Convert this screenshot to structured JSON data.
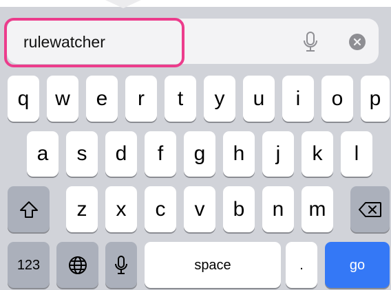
{
  "search": {
    "value": "rulewatcher"
  },
  "keyboard": {
    "row1": [
      "q",
      "w",
      "e",
      "r",
      "t",
      "y",
      "u",
      "i",
      "o",
      "p"
    ],
    "row2": [
      "a",
      "s",
      "d",
      "f",
      "g",
      "h",
      "j",
      "k",
      "l"
    ],
    "row3": [
      "z",
      "x",
      "c",
      "v",
      "b",
      "n",
      "m"
    ],
    "numbers_label": "123",
    "space_label": "space",
    "period_label": ".",
    "go_label": "go"
  },
  "colors": {
    "highlight": "#ec3c8c",
    "go_key": "#3478f6",
    "keyboard_bg": "#d1d3d9"
  },
  "icons": {
    "search_mic": "microphone-icon",
    "clear": "clear-x-icon",
    "shift": "shift-arrow-icon",
    "delete": "backspace-icon",
    "globe": "globe-icon",
    "dictation": "microphone-icon"
  }
}
